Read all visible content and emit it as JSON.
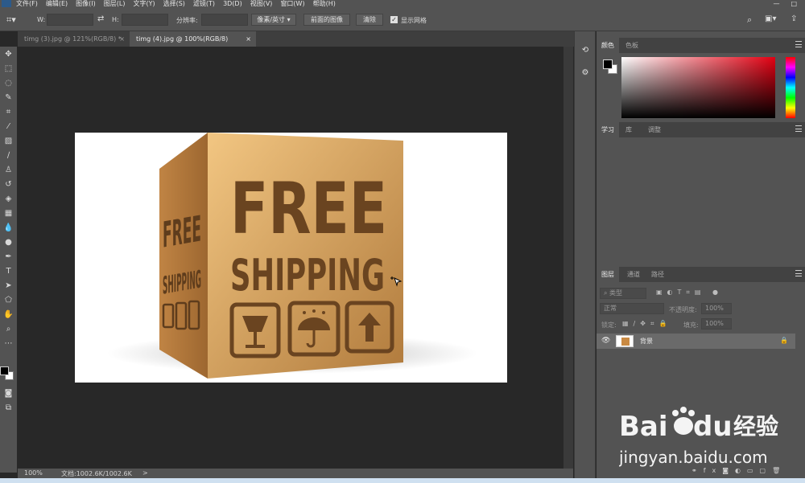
{
  "menubar": {
    "items": [
      "文件(F)",
      "编辑(E)",
      "图像(I)",
      "图层(L)",
      "文字(Y)",
      "选择(S)",
      "滤镜(T)",
      "3D(D)",
      "视图(V)",
      "窗口(W)",
      "帮助(H)"
    ]
  },
  "options": {
    "w_label": "W:",
    "h_label": "H:",
    "resolution_label": "分辨率:",
    "unit_select": "像素/英寸",
    "front_image_button": "前面的图像",
    "clear_button": "清除",
    "grid_label": "显示网格"
  },
  "tabs": [
    {
      "label": "timg (3).jpg @ 121%(RGB/8) *",
      "close": "×"
    },
    {
      "label": "timg (4).jpg @ 100%(RGB/8)",
      "close": "×"
    }
  ],
  "document": {
    "box_title_front": "FREE",
    "box_subtitle_front": "SHIPPING",
    "box_title_side": "FREE",
    "box_subtitle_side": "SHIPPING",
    "box_color": "#c98a43"
  },
  "status": {
    "zoom": "100%",
    "doc_size": "文档:1002.6K/1002.6K",
    "arrow": ">"
  },
  "panels": {
    "color_tabs": [
      "颜色",
      "色板"
    ],
    "learn_tabs": [
      "学习",
      "库",
      "调整"
    ],
    "layers_tabs": [
      "图层",
      "通道",
      "路径"
    ],
    "kind_filter": "类型",
    "blend_mode": "正常",
    "opacity_label": "不透明度:",
    "opacity_value": "100%",
    "lock_label": "锁定:",
    "fill_label": "填充:",
    "fill_value": "100%",
    "layer_name": "背景"
  },
  "watermark": {
    "brand": "Bai",
    "brand2": "du",
    "brand_cn": "经验",
    "url": "jingyan.baidu.com"
  },
  "colors": {
    "ui_gray": "#535353",
    "canvas_bg": "#282828",
    "accent_blue": "#2c6ab3"
  }
}
